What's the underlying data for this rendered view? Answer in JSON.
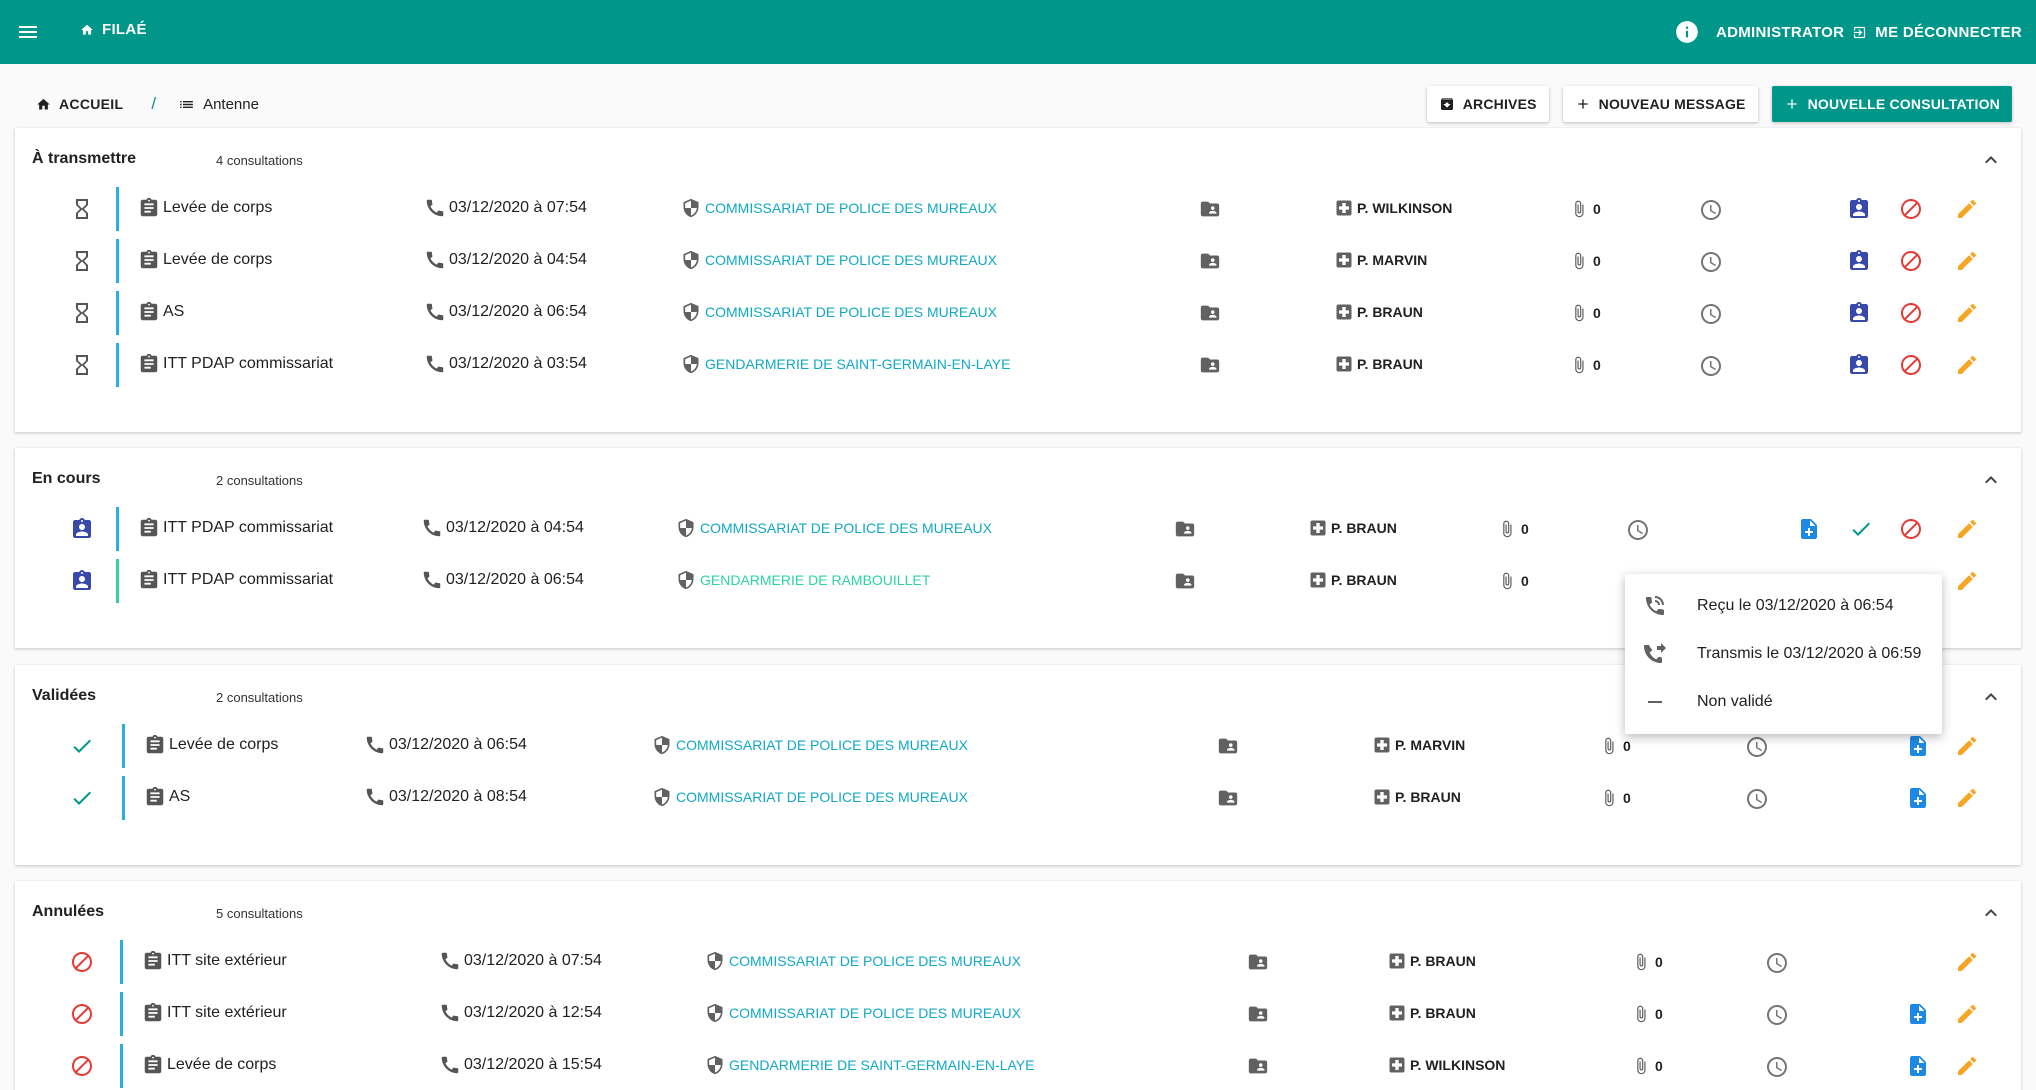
{
  "colors": {
    "primary": "#00968a",
    "link": "#11a8c6",
    "link_alt": "#2ed3a3",
    "blue_icon": "#3949ab",
    "edit": "#f5a623",
    "cancel": "#e53935",
    "file_icon": "#1e88e5"
  },
  "topbar": {
    "app_name": "FILAÉ",
    "user_label": "ADMINISTRATOR",
    "logout_label": "ME DÉCONNECTER"
  },
  "breadcrumb": {
    "home": "ACCUEIL",
    "separator": "/",
    "current": "Antenne"
  },
  "actions": {
    "archives": "ARCHIVES",
    "new_message": "NOUVEAU MESSAGE",
    "new_consultation": "NOUVELLE CONSULTATION"
  },
  "sections": [
    {
      "title": "À transmettre",
      "count": "4 consultations",
      "rows": [
        {
          "type": "Levée de corps",
          "date": "03/12/2020 à 07:54",
          "org": "COMMISSARIAT DE POLICE DES MUREAUX",
          "doctor": "P. WILKINSON",
          "attachments": "0"
        },
        {
          "type": "Levée de corps",
          "date": "03/12/2020 à 04:54",
          "org": "COMMISSARIAT DE POLICE DES MUREAUX",
          "doctor": "P. MARVIN",
          "attachments": "0"
        },
        {
          "type": "AS",
          "date": "03/12/2020 à 06:54",
          "org": "COMMISSARIAT DE POLICE DES MUREAUX",
          "doctor": "P. BRAUN",
          "attachments": "0"
        },
        {
          "type": "ITT PDAP commissariat",
          "date": "03/12/2020 à 03:54",
          "org": "GENDARMERIE DE SAINT-GERMAIN-EN-LAYE",
          "doctor": "P. BRAUN",
          "attachments": "0"
        }
      ]
    },
    {
      "title": "En cours",
      "count": "2 consultations",
      "rows": [
        {
          "type": "ITT PDAP commissariat",
          "date": "03/12/2020 à 04:54",
          "org": "COMMISSARIAT DE POLICE DES MUREAUX",
          "doctor": "P. BRAUN",
          "attachments": "0"
        },
        {
          "type": "ITT PDAP commissariat",
          "date": "03/12/2020 à 06:54",
          "org": "GENDARMERIE DE RAMBOUILLET",
          "doctor": "P. BRAUN",
          "attachments": "0"
        }
      ]
    },
    {
      "title": "Validées",
      "count": "2 consultations",
      "rows": [
        {
          "type": "Levée de corps",
          "date": "03/12/2020 à 06:54",
          "org": "COMMISSARIAT DE POLICE DES MUREAUX",
          "doctor": "P. MARVIN",
          "attachments": "0"
        },
        {
          "type": "AS",
          "date": "03/12/2020 à 08:54",
          "org": "COMMISSARIAT DE POLICE DES MUREAUX",
          "doctor": "P. BRAUN",
          "attachments": "0"
        }
      ]
    },
    {
      "title": "Annulées",
      "count": "5 consultations",
      "rows": [
        {
          "type": "ITT site extérieur",
          "date": "03/12/2020 à 07:54",
          "org": "COMMISSARIAT DE POLICE DES MUREAUX",
          "doctor": "P. BRAUN",
          "attachments": "0"
        },
        {
          "type": "ITT site extérieur",
          "date": "03/12/2020 à 12:54",
          "org": "COMMISSARIAT DE POLICE DES MUREAUX",
          "doctor": "P. BRAUN",
          "attachments": "0"
        },
        {
          "type": "Levée de corps",
          "date": "03/12/2020 à 15:54",
          "org": "GENDARMERIE DE SAINT-GERMAIN-EN-LAYE",
          "doctor": "P. WILKINSON",
          "attachments": "0"
        }
      ]
    }
  ],
  "popup": {
    "items": [
      {
        "icon": "phone-received-icon",
        "label": "Reçu le 03/12/2020 à 06:54"
      },
      {
        "icon": "phone-forwarded-icon",
        "label": "Transmis le 03/12/2020 à 06:59"
      },
      {
        "icon": "dash-icon",
        "label": "Non validé"
      }
    ]
  }
}
